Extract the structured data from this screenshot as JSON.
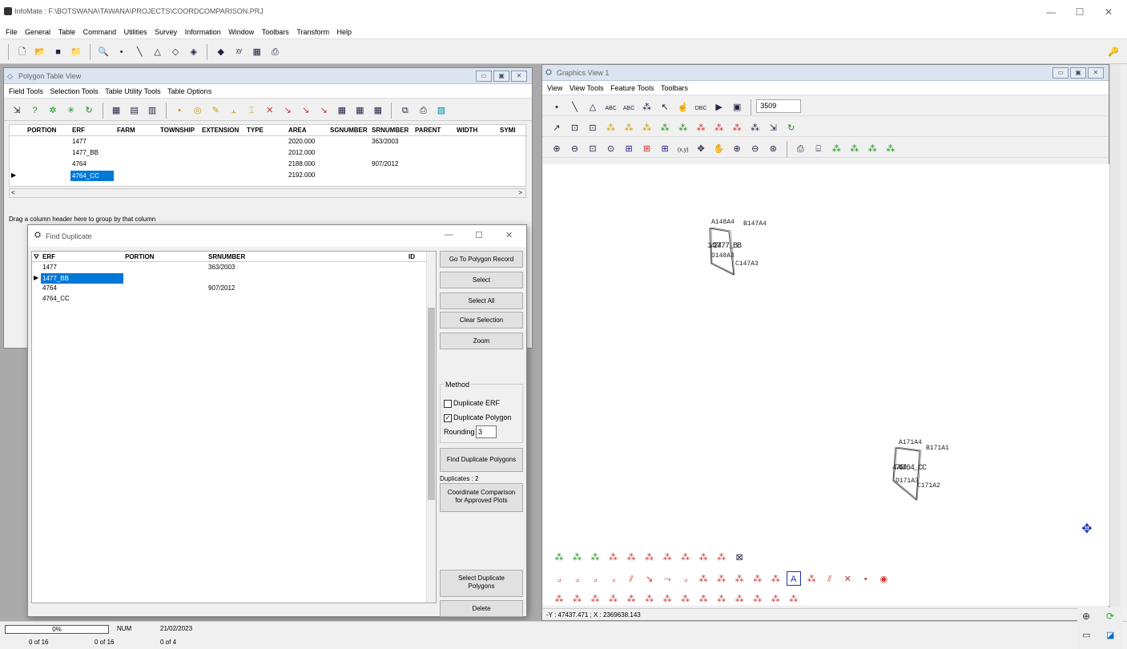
{
  "app": {
    "title": "InfoMate : F:\\BOTSWANA\\TAWANA\\PROJECTS\\COORDCOMPARISON.PRJ",
    "menu": [
      "File",
      "General",
      "Table",
      "Command",
      "Utilities",
      "Survey",
      "Information",
      "Window",
      "Toolbars",
      "Transform",
      "Help"
    ],
    "controls": {
      "minimize": "—",
      "maximize": "☐",
      "close": "✕"
    }
  },
  "polygon_table": {
    "title": "Polygon Table View",
    "menu": [
      "Field Tools",
      "Selection Tools",
      "Table Utility Tools",
      "Table Options"
    ],
    "columns": [
      "PORTION",
      "ERF",
      "FARM",
      "TOWNSHIP",
      "EXTENSION",
      "TYPE",
      "AREA",
      "SGNUMBER",
      "SRNUMBER",
      "PARENT",
      "WIDTH",
      "SYMI"
    ],
    "rows": [
      {
        "erf": "1477",
        "area": "2020.000",
        "srnumber": "363/2003"
      },
      {
        "erf": "1477_BB",
        "area": "2012.000",
        "srnumber": ""
      },
      {
        "erf": "4764",
        "area": "2188.000",
        "srnumber": "907/2012"
      },
      {
        "erf": "4764_CC",
        "area": "2192.000",
        "srnumber": ""
      }
    ],
    "group_hint": "Drag a column header here to group by that column"
  },
  "find_duplicate": {
    "title": "Find Duplicate",
    "columns": [
      "ERF",
      "PORTION",
      "SRNUMBER",
      "ID"
    ],
    "rows": [
      {
        "erf": "1477",
        "portion": "",
        "srnumber": "363/2003"
      },
      {
        "erf": "1477_BB",
        "portion": "",
        "srnumber": ""
      },
      {
        "erf": "4764",
        "portion": "",
        "srnumber": "907/2012"
      },
      {
        "erf": "4764_CC",
        "portion": "",
        "srnumber": ""
      }
    ],
    "buttons": {
      "goto": "Go To Polygon Record",
      "select": "Select",
      "select_all": "Select All",
      "clear": "Clear Selection",
      "zoom": "Zoom",
      "find": "Find Duplicate Polygons",
      "coord1": "Coordinate Comparison",
      "coord2": "for Approved Plots",
      "seldup1": "Select Duplicate",
      "seldup2": "Polygons",
      "delete": "Delete"
    },
    "method": {
      "label": "Method",
      "dup_erf": "Duplicate ERF",
      "dup_erf_checked": false,
      "dup_poly": "Duplicate Polygon",
      "dup_poly_checked": true,
      "rounding_label": "Rounding",
      "rounding_value": "3"
    },
    "duplicates_text": "Duplicates : 2"
  },
  "graphics": {
    "title": "Graphics View 1",
    "menu": [
      "View",
      "View Tools",
      "Feature Tools",
      "Toolbars"
    ],
    "field_value": "3509",
    "labels": {
      "a148": "A148A4",
      "b147": "B147A4",
      "l1477": "1477",
      "lbb": "1477_BB",
      "d148": "D148A3",
      "c147": "C147A3",
      "a171": "A171A4",
      "b171": "B171A1",
      "l4764": "4764",
      "lcc": "4764_CC",
      "d171": "D171A3",
      "c171": "C171A2"
    },
    "coords": "-Y : 47437.471 ; X : 2369638.143"
  },
  "status": {
    "progress": "0%",
    "num": "NUM",
    "date": "21/02/2023",
    "c1": "0 of 16",
    "c2": "0 of 16",
    "c3": "0 of 4"
  }
}
